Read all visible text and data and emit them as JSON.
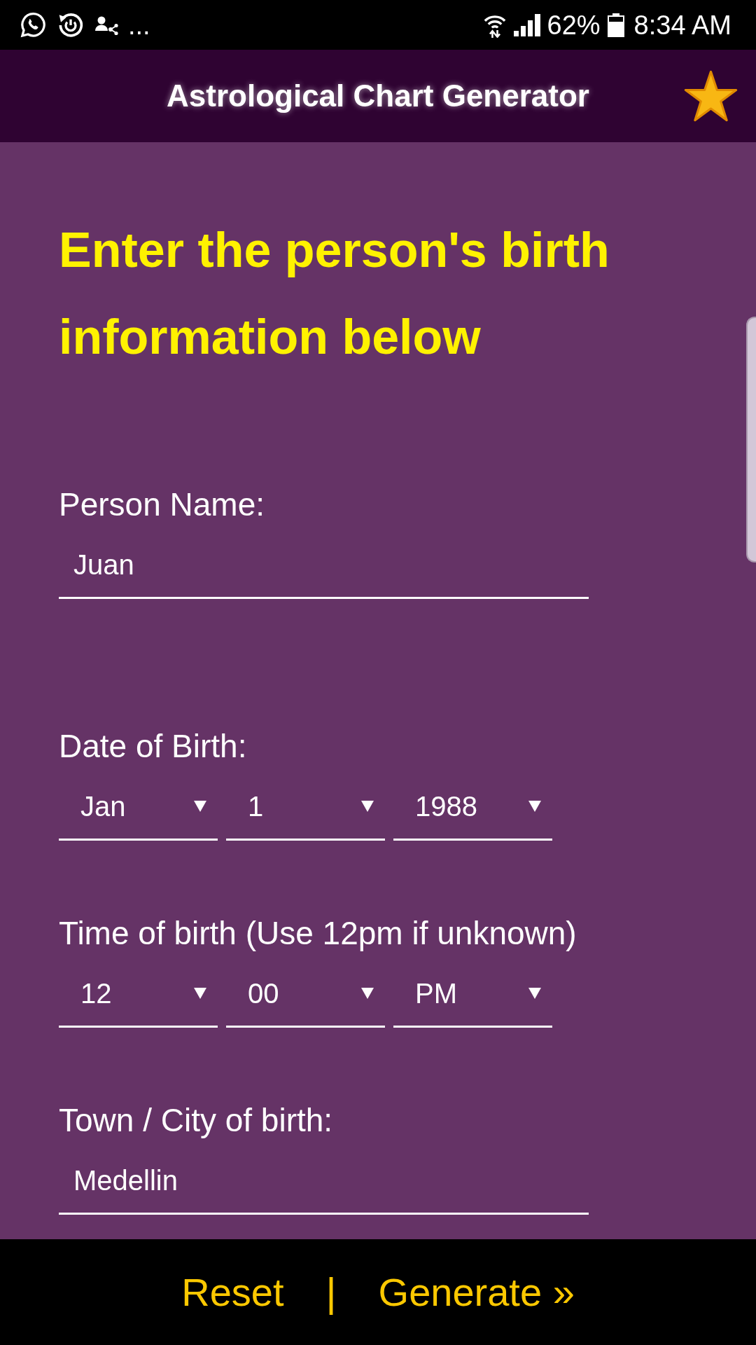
{
  "status_bar": {
    "overflow": "...",
    "battery": "62%",
    "time": "8:34 AM"
  },
  "header": {
    "title": "Astrological Chart Generator"
  },
  "heading": "Enter the person's birth information below",
  "fields": [
    {
      "kind": "text",
      "label": "Person Name:",
      "value": "Juan"
    },
    {
      "kind": "select",
      "label": "Date of Birth:",
      "selects": [
        "Jan",
        "1",
        "1988"
      ]
    },
    {
      "kind": "select",
      "label": "Time of birth (Use 12pm if unknown)",
      "selects": [
        "12",
        "00",
        "PM"
      ]
    },
    {
      "kind": "text",
      "label": "Town / City of birth:",
      "value": "Medellin"
    }
  ],
  "actions": [
    {
      "kind": "button",
      "label": "Reset"
    },
    {
      "kind": "divider",
      "label": "|"
    },
    {
      "kind": "button",
      "label": "Generate »"
    }
  ]
}
